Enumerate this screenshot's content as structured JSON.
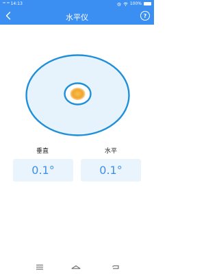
{
  "status_bar": {
    "signal_text": "ᴴᴰ ",
    "time": "14:13",
    "wifi_icon": "wifi-icon",
    "battery_text": "100%"
  },
  "title_bar": {
    "title": "水平仪",
    "back_icon": "chevron-left-icon",
    "help_label": "?"
  },
  "level": {
    "bubble_color": "#f2a52e",
    "ring_color": "#1e8fd8",
    "fill_color": "#e7f3fc"
  },
  "readings": {
    "vertical_label": "垂直",
    "vertical_value": "0.1°",
    "horizontal_label": "水平",
    "horizontal_value": "0.1°"
  },
  "nav": {
    "menu_icon": "menu-icon",
    "home_icon": "home-icon",
    "back_icon": "back-icon"
  },
  "colors": {
    "accent": "#3b8ff3",
    "value_text": "#3f8fe8",
    "card_bg": "#eaf4fc"
  }
}
